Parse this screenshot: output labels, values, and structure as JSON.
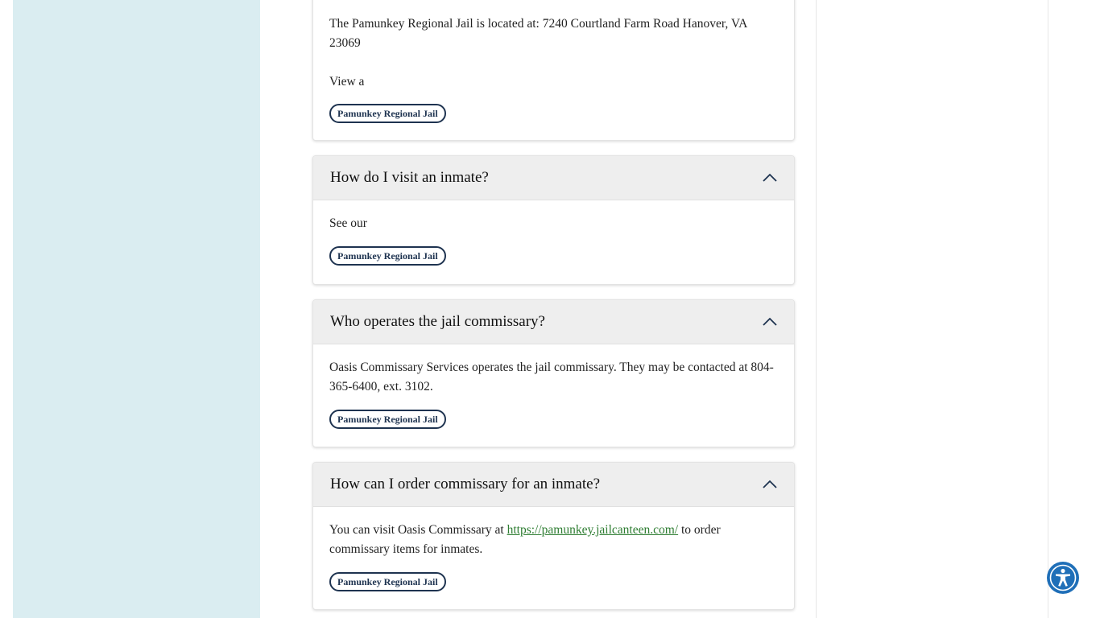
{
  "cards": [
    {
      "body_text": "The Pamunkey Regional Jail is located at: 7240 Courtland Farm Road Hanover, VA 23069",
      "body_text_2": "View a",
      "tag": "Pamunkey Regional Jail"
    },
    {
      "question": "How do I visit an inmate?",
      "body_text": "See our",
      "tag": "Pamunkey Regional Jail"
    },
    {
      "question": "Who operates the jail commissary?",
      "body_text": "Oasis Commissary Services operates the jail commissary. They may be contacted at 804-365-6400, ext. 3102.",
      "tag": "Pamunkey Regional Jail"
    },
    {
      "question": "How can I order commissary for an inmate?",
      "body_text_before": "You can visit Oasis Commissary at",
      "link_text": "https://pamunkey.jailcanteen.com/",
      "body_text_after": "to order commissary items for inmates.",
      "tag": "Pamunkey Regional Jail"
    }
  ],
  "icons": {
    "chevron": "chevron-up-icon",
    "accessibility": "accessibility-icon"
  },
  "colors": {
    "sidebar_bg": "#daedf1",
    "tag_border": "#1e3350",
    "link": "#2e7d32",
    "a11y_button": "#1f6fb8",
    "card_header_bg": "#eeeeee"
  }
}
